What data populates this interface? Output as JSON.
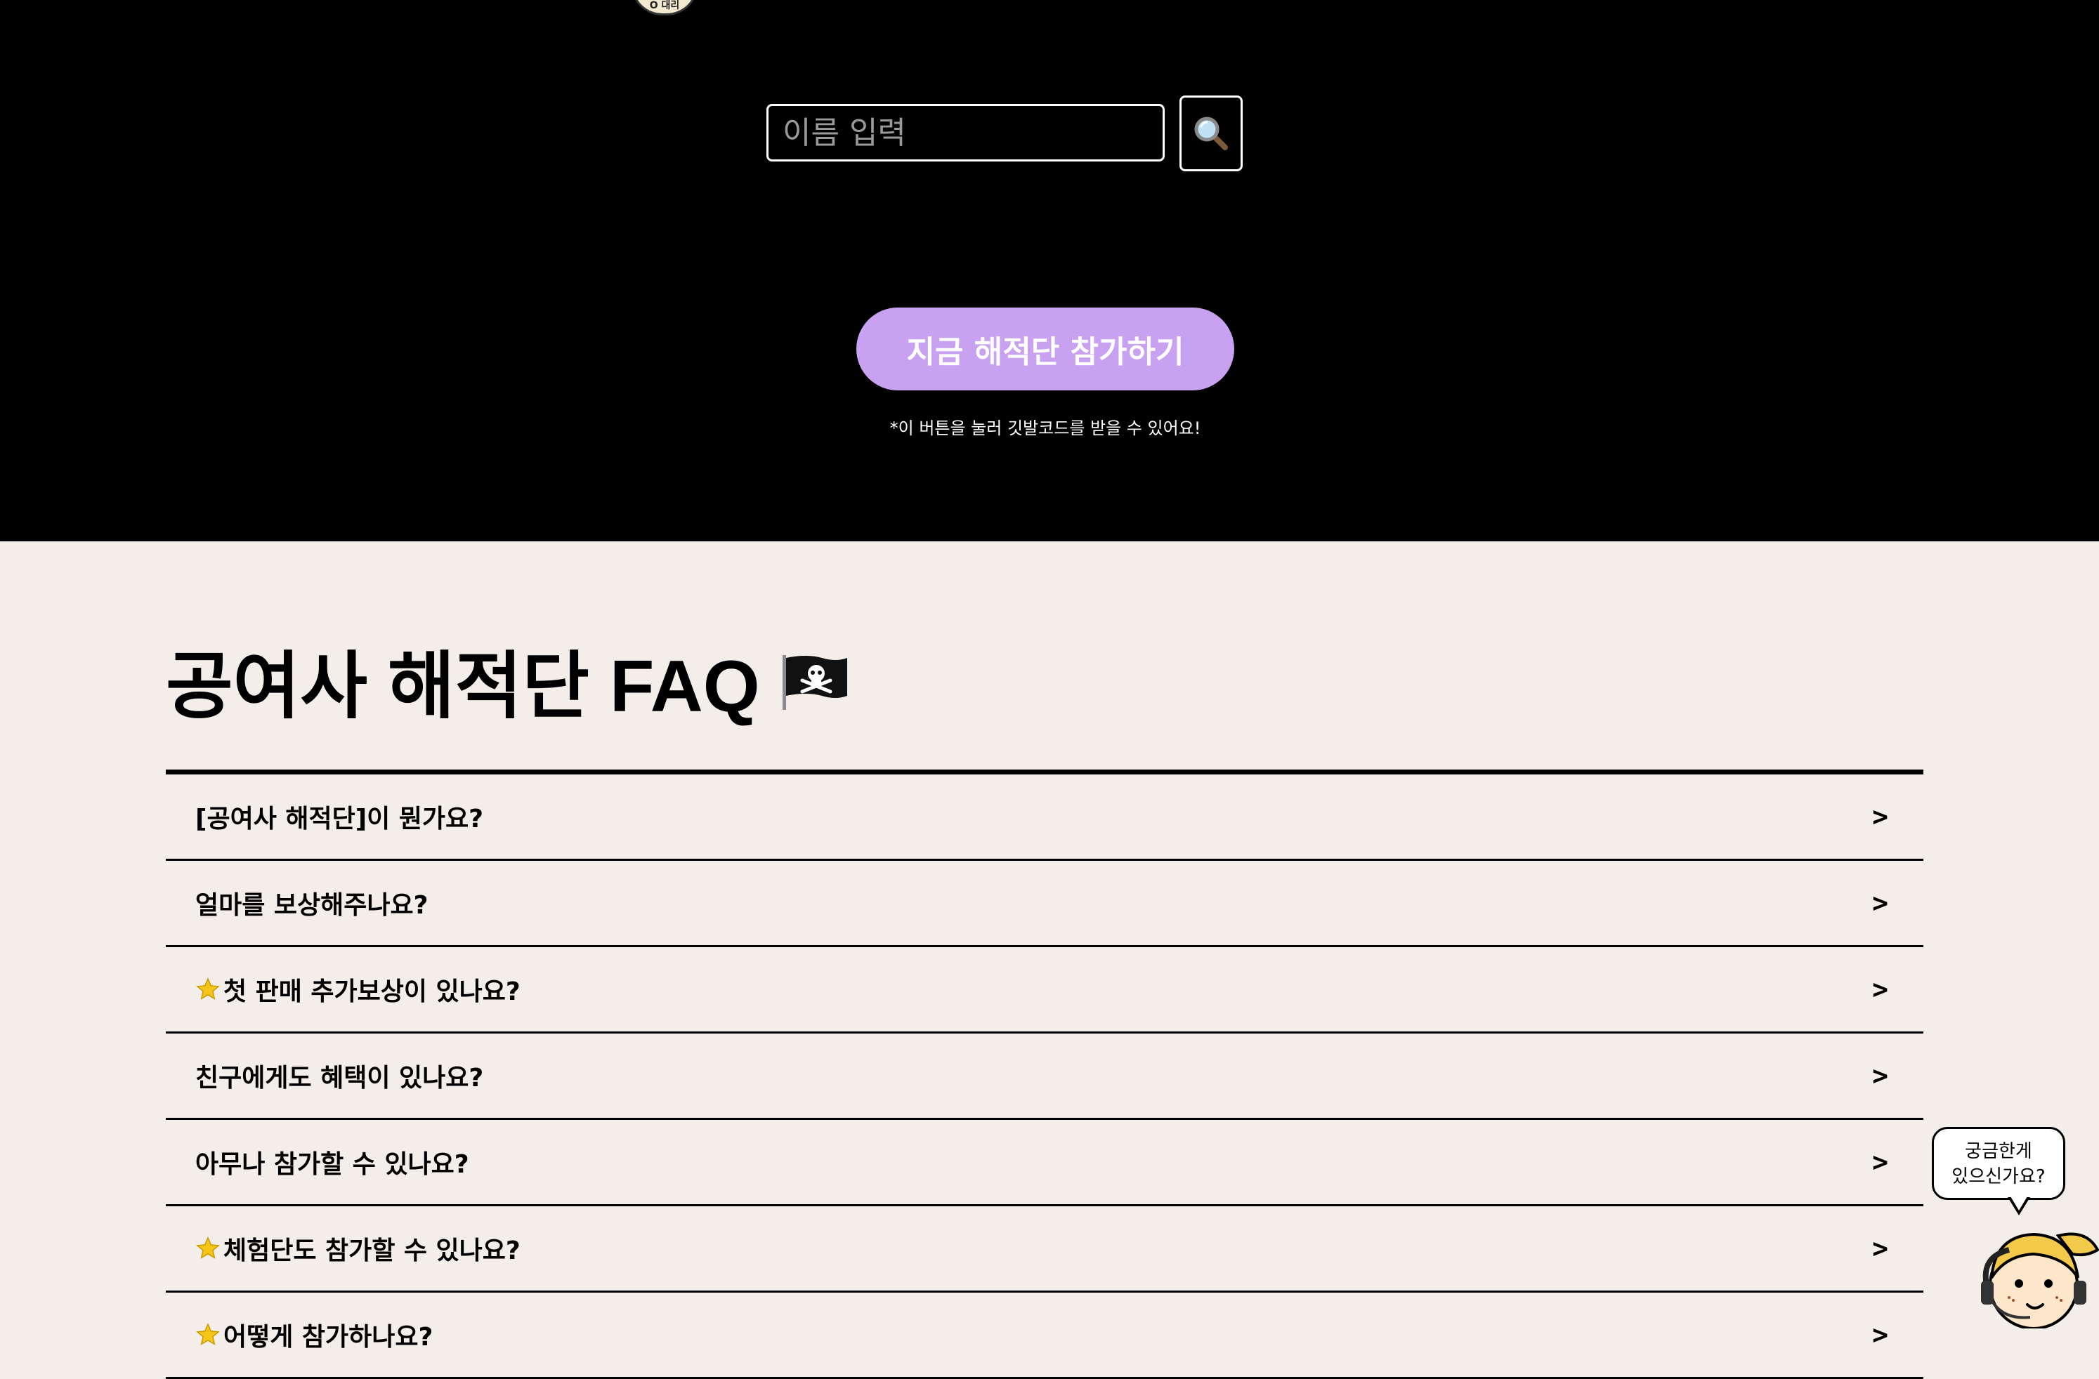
{
  "hero": {
    "logo_text": "O 대리",
    "search": {
      "placeholder": "이름 입력",
      "icon": "magnifier-icon"
    },
    "join_button_label": "지금 해적단 참가하기",
    "hint_text": "*이 버튼을 눌러 깃발코드를 받을 수 있어요!"
  },
  "faq": {
    "title": "공여사 해적단 FAQ",
    "title_icon": "pirate-flag-icon",
    "items": [
      {
        "question": "[공여사 해적단]이 뭔가요?",
        "star": false,
        "chevron": ">"
      },
      {
        "question": "얼마를 보상해주나요?",
        "star": false,
        "chevron": ">"
      },
      {
        "question": "첫 판매 추가보상이 있나요?",
        "star": true,
        "chevron": ">"
      },
      {
        "question": "친구에게도 혜택이 있나요?",
        "star": false,
        "chevron": ">"
      },
      {
        "question": "아무나 참가할 수 있나요?",
        "star": false,
        "chevron": ">"
      },
      {
        "question": "체험단도 참가할 수 있나요?",
        "star": true,
        "chevron": ">"
      },
      {
        "question": "어떻게 참가하나요?",
        "star": true,
        "chevron": ">"
      }
    ]
  },
  "helper": {
    "bubble_line1": "궁금한게",
    "bubble_line2": "있으신가요?",
    "icon": "helper-character-icon"
  },
  "colors": {
    "hero_bg": "#000000",
    "page_bg": "#f4eeea",
    "accent_button": "#c8a2f0",
    "star": "#f5c518"
  }
}
